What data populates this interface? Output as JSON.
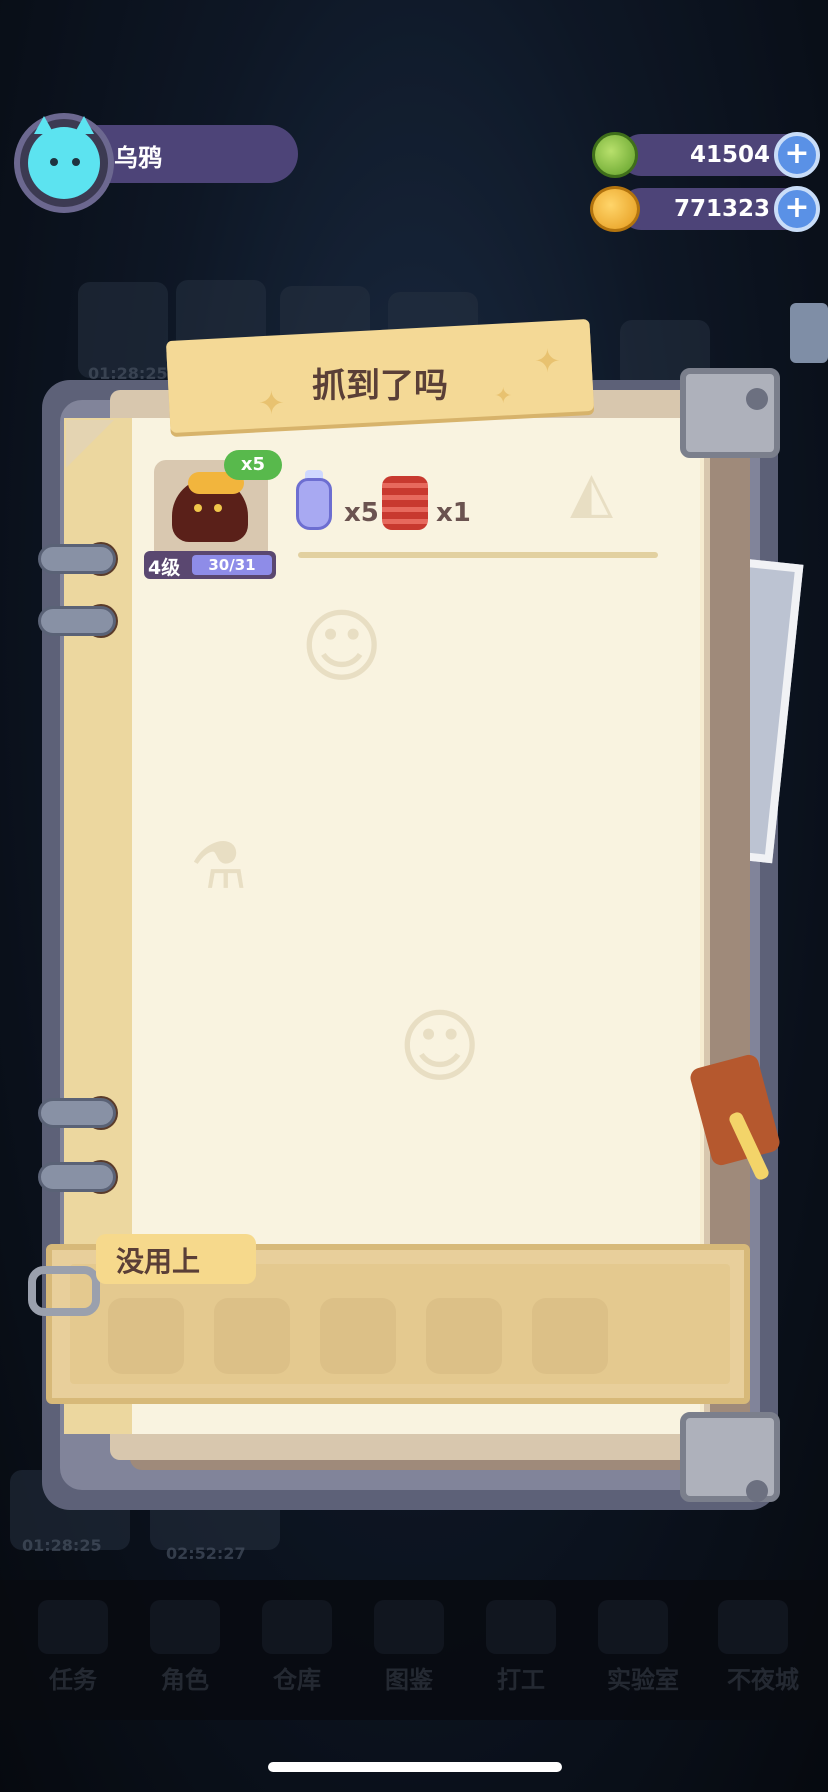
{
  "player": {
    "name": "乌鸦",
    "avatar_icon": "cat-avatar-icon"
  },
  "resources": [
    {
      "icon": "green-coin-icon",
      "value": "41504",
      "add_label": "+"
    },
    {
      "icon": "gold-planet-icon",
      "value": "771323",
      "add_label": "+"
    }
  ],
  "background": {
    "timers": [
      "01:28:25",
      "01:28:25",
      "02:52:27"
    ],
    "nav": [
      "任务",
      "角色",
      "仓库",
      "图鉴",
      "打工",
      "实验室",
      "不夜城"
    ]
  },
  "notebook": {
    "title": "抓到了吗",
    "caught": {
      "monster_icon": "lava-monster-icon",
      "count_badge": "x5",
      "level": "4级",
      "exp": "30/31",
      "exp_fraction": 0.968
    },
    "items": [
      {
        "icon": "potion-bottle-icon",
        "count": "x5"
      },
      {
        "icon": "red-spring-icon",
        "count": "x1"
      }
    ],
    "unused_label": "没用上",
    "unused_slots": 5
  },
  "colors": {
    "panel_purple": "#4d4478",
    "plus_blue": "#5a91e6",
    "badge_green": "#58b94c",
    "title_yellow": "#f4d996",
    "paper": "#f9f3e0"
  }
}
